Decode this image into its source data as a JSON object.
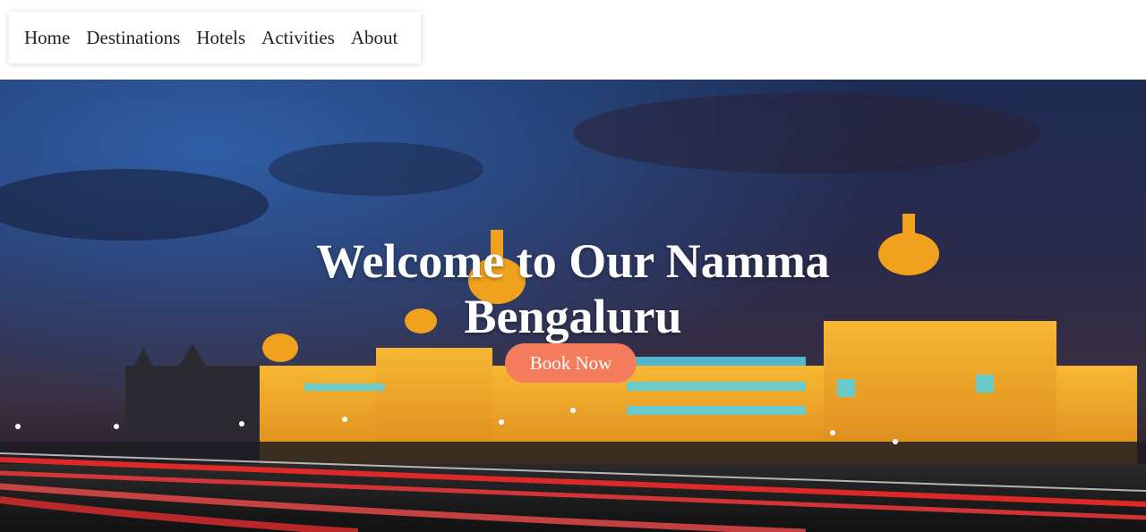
{
  "nav": {
    "items": [
      {
        "label": "Home"
      },
      {
        "label": "Destinations"
      },
      {
        "label": "Hotels"
      },
      {
        "label": "Activities"
      },
      {
        "label": "About"
      }
    ]
  },
  "hero": {
    "title": "Welcome to Our Namma Bengaluru",
    "cta_label": "Book Now",
    "image_subject": "Vidhana Soudha at night",
    "colors": {
      "cta": "#f47c5c",
      "building": "#f0a21e",
      "sky": "#1c2b52"
    }
  }
}
